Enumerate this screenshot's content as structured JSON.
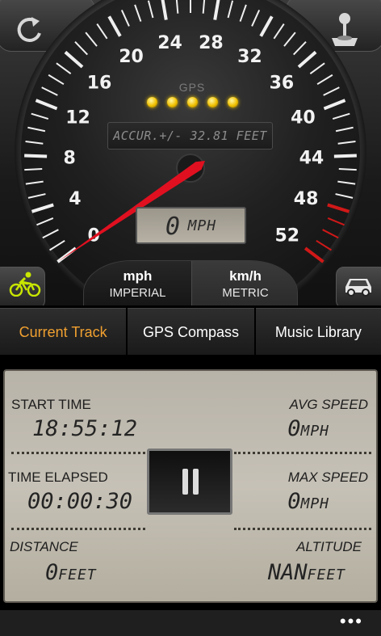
{
  "gauge": {
    "dial_numbers": [
      "0",
      "4",
      "8",
      "12",
      "16",
      "20",
      "24",
      "28",
      "32",
      "36",
      "40",
      "44",
      "48",
      "52"
    ],
    "gps_label": "GPS",
    "gps_signal_dots": 5,
    "accuracy_text": "ACCUR.+/- 32.81 FEET",
    "speed_value": "0",
    "speed_unit": "MPH",
    "needle_speed": 0
  },
  "units": {
    "imperial": {
      "main": "mph",
      "sub": "IMPERIAL"
    },
    "metric": {
      "main": "km/h",
      "sub": "METRIC"
    }
  },
  "tabs": [
    {
      "label": "Current Track",
      "active": true
    },
    {
      "label": "GPS Compass",
      "active": false
    },
    {
      "label": "Music Library",
      "active": false
    }
  ],
  "track": {
    "start_time": {
      "label": "START TIME",
      "value": "18:55:12"
    },
    "time_elapsed": {
      "label": "TIME ELAPSED",
      "value": "00:00:30"
    },
    "distance": {
      "label": "DISTANCE",
      "value": "0",
      "unit": "FEET"
    },
    "avg_speed": {
      "label": "AVG SPEED",
      "value": "0",
      "unit": "MPH"
    },
    "max_speed": {
      "label": "MAX SPEED",
      "value": "0",
      "unit": "MPH"
    },
    "altitude": {
      "label": "ALTITUDE",
      "value": "NAN",
      "unit": "FEET"
    }
  },
  "app_bar": {
    "more_label": "•••"
  },
  "icons": {
    "refresh": "refresh-icon",
    "joystick": "joystick-icon",
    "bike": "bicycle-icon",
    "car": "car-icon"
  },
  "colors": {
    "accent": "#f0a030",
    "bike_icon": "#c8e600",
    "gps_dot": "#f0c000",
    "needle": "#e01020",
    "red_zone": "#d01818"
  }
}
